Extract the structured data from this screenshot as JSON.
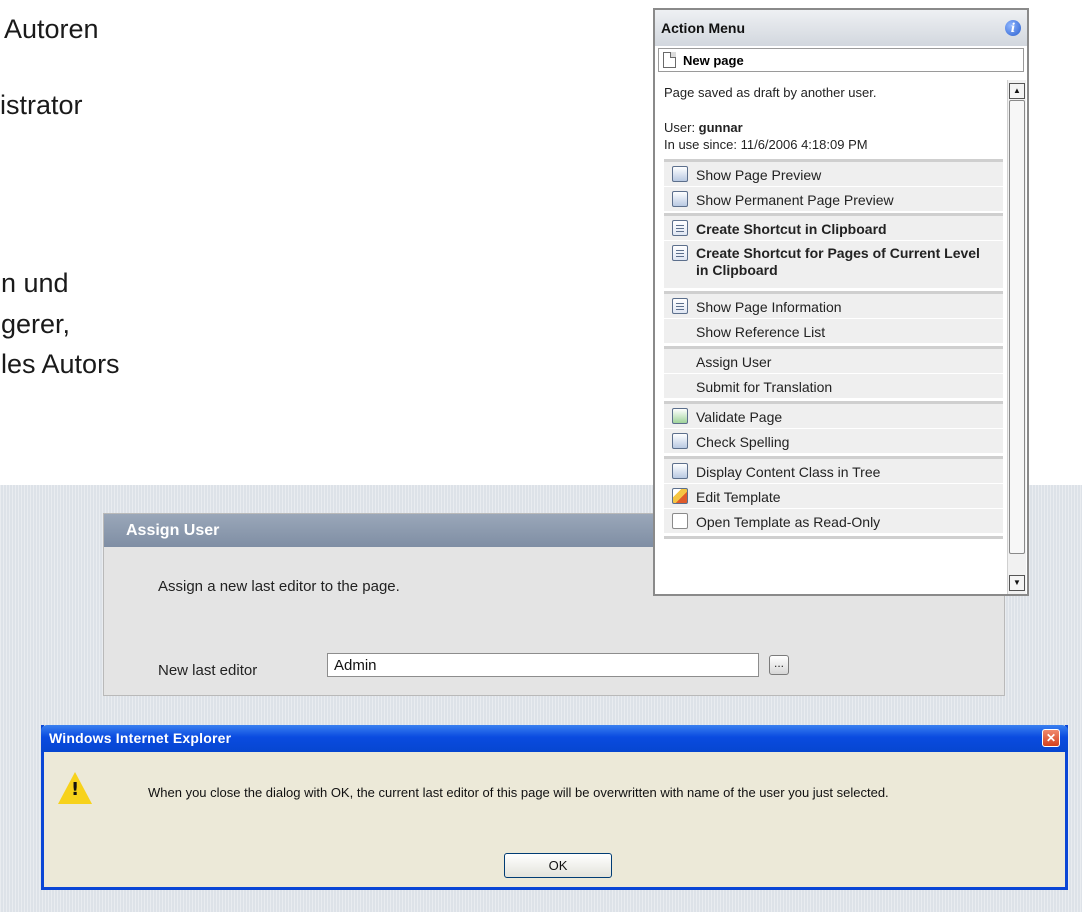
{
  "slide": {
    "line1": "Autoren",
    "line2": "istrator",
    "line3": "n und",
    "line4": "gerer,",
    "line5": "les Autors"
  },
  "assign_user": {
    "title": "Assign User",
    "description": "Assign a new last editor to the page.",
    "field_label": "New last editor",
    "field_value": "Admin",
    "browse_label": "..."
  },
  "action_menu": {
    "title": "Action Menu",
    "info_icon": "i",
    "page_name": "New page",
    "status": "Page saved as draft by another user.",
    "user_label": "User: ",
    "user_name": "gunnar",
    "in_use": "In use since: 11/6/2006 4:18:09 PM",
    "items": [
      {
        "label": "Show Page Preview",
        "icon": "preview-icon"
      },
      {
        "label": "Show Permanent Page Preview",
        "icon": "permanent-preview-icon"
      },
      {
        "label": "Create Shortcut in Clipboard",
        "icon": "clipboard-icon"
      },
      {
        "label": "Create Shortcut for Pages of Current Level in Clipboard",
        "icon": "clipboard-icon"
      },
      {
        "label": "Show Page Information",
        "icon": "page-info-icon"
      },
      {
        "label": "Show Reference List",
        "icon": ""
      },
      {
        "label": "Assign User",
        "icon": ""
      },
      {
        "label": "Submit for Translation",
        "icon": ""
      },
      {
        "label": "Validate Page",
        "icon": "validate-icon"
      },
      {
        "label": "Check Spelling",
        "icon": "spelling-icon"
      },
      {
        "label": "Display Content Class in Tree",
        "icon": "content-class-icon"
      },
      {
        "label": "Edit Template",
        "icon": "pencil-icon"
      },
      {
        "label": "Open Template as Read-Only",
        "icon": "read-only-icon"
      }
    ]
  },
  "alert": {
    "title": "Windows Internet Explorer",
    "close": "✕",
    "message": "When you close the dialog with OK, the current last editor of this page will be overwritten with name of the user you just selected.",
    "ok_label": "OK"
  }
}
